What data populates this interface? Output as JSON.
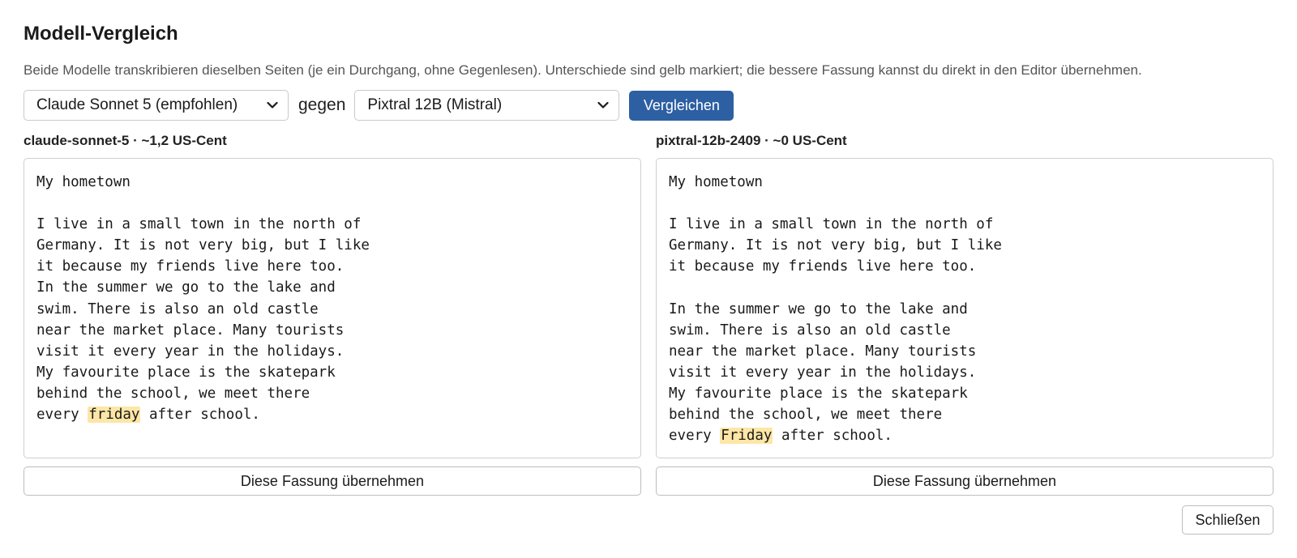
{
  "dialog": {
    "title": "Modell-Vergleich",
    "description": "Beide Modelle transkribieren dieselben Seiten (je ein Durchgang, ohne Gegenlesen). Unterschiede sind gelb markiert; die bessere Fassung kannst du direkt in den Editor übernehmen."
  },
  "controls": {
    "model_a_selected": "Claude Sonnet 5 (empfohlen)",
    "versus_label": "gegen",
    "model_b_selected": "Pixtral 12B (Mistral)",
    "compare_button": "Vergleichen"
  },
  "left_panel": {
    "label": "claude-sonnet-5 · ~1,2 US-Cent",
    "lines": [
      "My hometown",
      "",
      "I live in a small town in the north of",
      "Germany. It is not very big, but I like",
      "it because my friends live here too.",
      "In the summer we go to the lake and",
      "swim. There is also an old castle",
      "near the market place. Many tourists",
      "visit it every year in the holidays.",
      "My favourite place is the skatepark",
      "behind the school, we meet there"
    ],
    "last_line_before": "every ",
    "last_line_highlight": "friday",
    "last_line_after": " after school.",
    "adopt_button": "Diese Fassung übernehmen"
  },
  "right_panel": {
    "label": "pixtral-12b-2409 · ~0 US-Cent",
    "lines": [
      "My hometown",
      "",
      "I live in a small town in the north of",
      "Germany. It is not very big, but I like",
      "it because my friends live here too.",
      "",
      "In the summer we go to the lake and",
      "swim. There is also an old castle",
      "near the market place. Many tourists",
      "visit it every year in the holidays.",
      "My favourite place is the skatepark",
      "behind the school, we meet there"
    ],
    "last_line_before": "every ",
    "last_line_highlight": "Friday",
    "last_line_after": " after school.",
    "adopt_button": "Diese Fassung übernehmen"
  },
  "footer": {
    "close_button": "Schließen"
  },
  "colors": {
    "primary_button": "#2d5fa3",
    "diff_highlight": "#fde6a6"
  },
  "icons": {
    "select_arrow": "chevron-down-icon"
  }
}
